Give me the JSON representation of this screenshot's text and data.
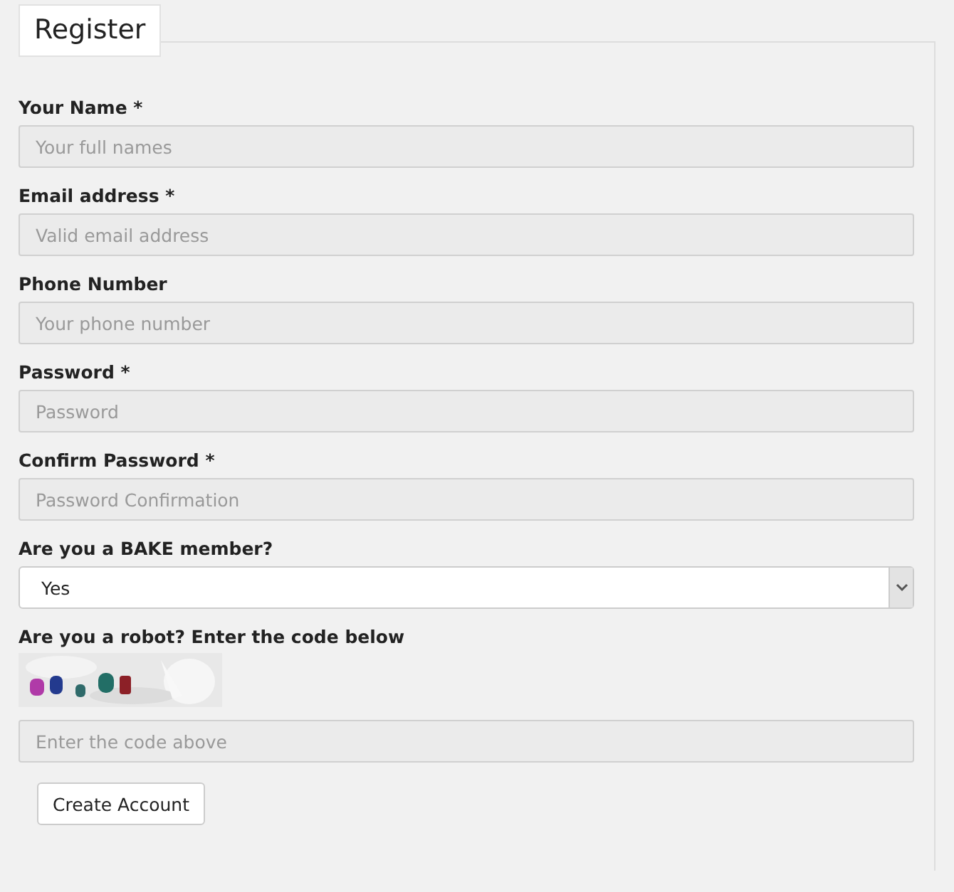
{
  "legend": "Register",
  "fields": [
    {
      "kind": "input",
      "label": "Your Name *",
      "placeholder": "Your full names"
    },
    {
      "kind": "input",
      "label": "Email address *",
      "placeholder": "Valid email address"
    },
    {
      "kind": "input",
      "label": "Phone Number",
      "placeholder": "Your phone number"
    },
    {
      "kind": "input",
      "label": "Password *",
      "placeholder": "Password"
    },
    {
      "kind": "input",
      "label": "Confirm Password *",
      "placeholder": "Password Confirmation"
    },
    {
      "kind": "select",
      "label": "Are you a BAKE member?",
      "value": "Yes"
    },
    {
      "kind": "captcha",
      "label": "Are you a robot? Enter the code below",
      "placeholder": "Enter the code above"
    }
  ],
  "button": "Create Account"
}
